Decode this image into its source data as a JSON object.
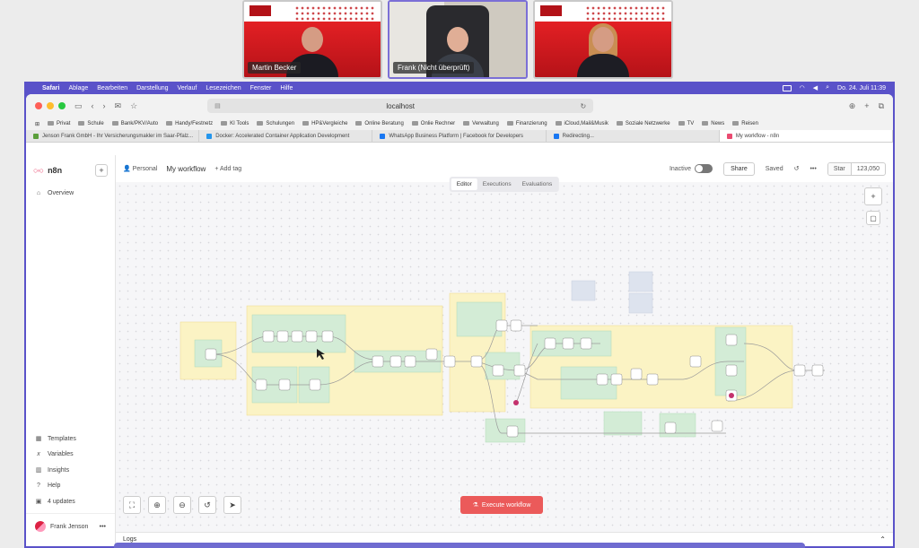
{
  "video": {
    "tiles": [
      {
        "name": "Martin Becker"
      },
      {
        "name": "Frank (Nicht überprüft)"
      },
      {
        "name": ""
      }
    ]
  },
  "menubar": {
    "items": [
      "Safari",
      "Ablage",
      "Bearbeiten",
      "Darstellung",
      "Verlauf",
      "Lesezeichen",
      "Fenster",
      "Hilfe"
    ],
    "clock": "Do. 24. Juli  11:39"
  },
  "browser": {
    "url": "localhost",
    "bookmarks": [
      "Privat",
      "Schule",
      "Bank/PKV/Auto",
      "Handy/Festnetz",
      "KI Tools",
      "Schulungen",
      "HP&Vergleiche",
      "Online Beratung",
      "Onlie Rechner",
      "Verwaltung",
      "Finanzierung",
      "iCloud,Mail&Musik",
      "Soziale Netzwerke",
      "TV",
      "News",
      "Reisen"
    ],
    "tabs": [
      {
        "label": "Jenson Frank GmbH - Ihr Versicherungsmakler im Saar-Pfalz...",
        "color": "#5a9e3a"
      },
      {
        "label": "Docker: Accelerated Container Application Development",
        "color": "#2496ed"
      },
      {
        "label": "WhatsApp Business Platform | Facebook for Developers",
        "color": "#1877f2"
      },
      {
        "label": "Redirecting...",
        "color": "#1877f2"
      },
      {
        "label": "My workflow - n8n",
        "color": "#ea4b71"
      }
    ]
  },
  "n8n": {
    "brand": "n8n",
    "sidebar": {
      "overview": "Overview",
      "templates": "Templates",
      "variables": "Variables",
      "insights": "Insights",
      "help": "Help",
      "updates": "4 updates",
      "user": "Frank Jenson"
    },
    "header": {
      "project": "Personal",
      "workflow": "My workflow",
      "add_tag": "+ Add tag",
      "status": "Inactive",
      "share": "Share",
      "saved": "Saved",
      "star": "Star",
      "stars": "123,050"
    },
    "view_tabs": [
      "Editor",
      "Executions",
      "Evaluations"
    ],
    "execute": "Execute workflow",
    "logs": "Logs"
  }
}
